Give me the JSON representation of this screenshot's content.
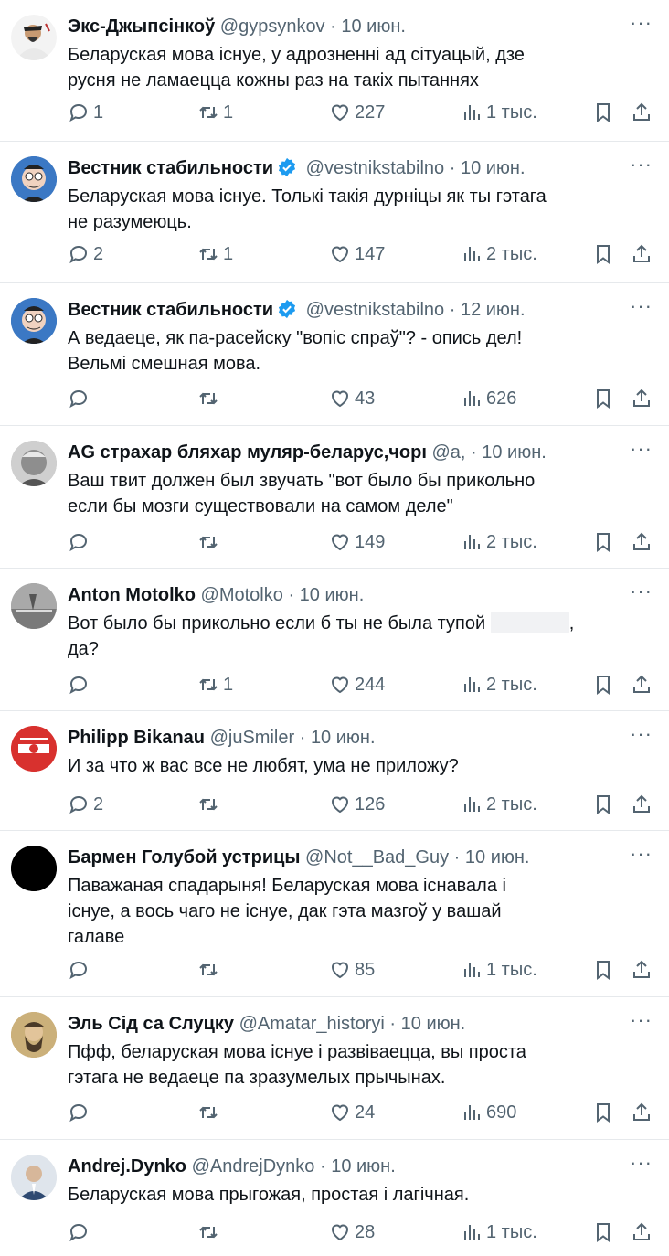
{
  "ui": {
    "more_label": "···",
    "dot": "·",
    "colors": {
      "text": "#0f1419",
      "secondary": "#536471",
      "verified": "#1d9bf0",
      "divider": "#e6e9ec"
    },
    "icons": [
      "reply-icon",
      "retweet-icon",
      "like-icon",
      "views-icon",
      "bookmark-icon",
      "share-icon",
      "verified-badge-icon",
      "more-icon"
    ]
  },
  "tweets": [
    {
      "name": "Экс-Джыпсінкоў",
      "handle": "@gypsynkov",
      "date": "10 июн.",
      "verified": false,
      "text": "Беларуская мова існуе, у адрозненні ад сітуацый, дзе\nрусня  не ламаецца кожны раз на такіх пытаннях",
      "replies": "1",
      "retweets": "1",
      "likes": "227",
      "views": "1 тыс."
    },
    {
      "name": "Вестник стабильности",
      "handle": "@vestnikstabilno",
      "date": "10 июн.",
      "verified": true,
      "text": "Беларуская мова існуе. Толькі такія дурніцы як ты гэтага\nне разумеюць.",
      "replies": "2",
      "retweets": "1",
      "likes": "147",
      "views": "2 тыс."
    },
    {
      "name": "Вестник стабильности",
      "handle": "@vestnikstabilno",
      "date": "12 июн.",
      "verified": true,
      "text": "А ведаеце, як па-расейску \"вопіс спраў\"? - опись дел!\nВельмі смешная мова.",
      "replies": "",
      "retweets": "",
      "likes": "43",
      "views": "626"
    },
    {
      "name": "AG страхар бляхар муляр-беларус,чорı",
      "handle": "@a,",
      "date": "10 июн.",
      "verified": false,
      "text": "Ваш твит должен был звучать \"вот было бы прикольно\nесли бы мозги существовали на самом деле\"",
      "replies": "",
      "retweets": "",
      "likes": "149",
      "views": "2 тыс."
    },
    {
      "name": "Anton Motolko",
      "handle": "@Motolko",
      "date": "10 июн.",
      "verified": false,
      "text_before": "Вот было бы прикольно если б ты не была тупой ",
      "text_after": ",\nда?",
      "replies": "",
      "retweets": "1",
      "likes": "244",
      "views": "2 тыс."
    },
    {
      "name": "Philipp Bikanau",
      "handle": "@juSmiler",
      "date": "10 июн.",
      "verified": false,
      "text": "И за что ж вас все не любят, ума не приложу?",
      "replies": "2",
      "retweets": "",
      "likes": "126",
      "views": "2 тыс."
    },
    {
      "name": "Бармен Голубой устрицы",
      "handle": "@Not__Bad_Guy",
      "date": "10 июн.",
      "verified": false,
      "text": "Паважаная спадарыня! Беларуская мова існавала і\nіснуе, а вось чаго не існуе, дак гэта мазгоў у вашай\nгалаве",
      "replies": "",
      "retweets": "",
      "likes": "85",
      "views": "1 тыс."
    },
    {
      "name": "Эль Сід са Слуцку",
      "handle": "@Amatar_historyi",
      "date": "10 июн.",
      "verified": false,
      "text": "Пфф, беларуская мова існуе і развіваецца, вы проста\nгэтага не ведаеце па зразумелых прычынах.",
      "replies": "",
      "retweets": "",
      "likes": "24",
      "views": "690"
    },
    {
      "name": "Andrej.Dynko",
      "handle": "@AndrejDynko",
      "date": "10 июн.",
      "verified": false,
      "text": "Беларуская мова прыгожая, простая і лагічная.",
      "replies": "",
      "retweets": "",
      "likes": "28",
      "views": "1 тыс."
    }
  ]
}
